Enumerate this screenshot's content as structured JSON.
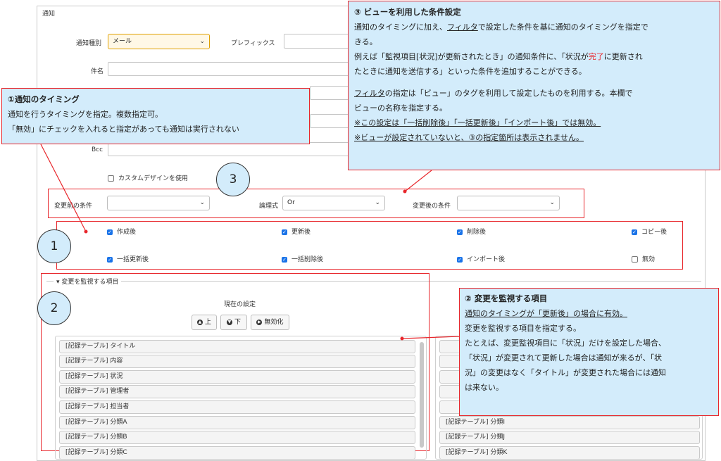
{
  "panel": {
    "title": "通知"
  },
  "form": {
    "notif_type_label": "通知種別",
    "notif_type_value": "メール",
    "prefix_label": "プレフィックス",
    "subject_label": "件名",
    "bcc_label": "Bcc",
    "custom_design_label": "カスタムデザインを使用",
    "before_condition_label": "変更前の条件",
    "logic_label": "論理式",
    "logic_value": "Or",
    "after_condition_label": "変更後の条件"
  },
  "timing": {
    "items": [
      {
        "label": "作成後",
        "checked": true
      },
      {
        "label": "更新後",
        "checked": true
      },
      {
        "label": "削除後",
        "checked": true
      },
      {
        "label": "コピー後",
        "checked": true
      },
      {
        "label": "一括更新後",
        "checked": true
      },
      {
        "label": "一括削除後",
        "checked": true
      },
      {
        "label": "インポート後",
        "checked": true
      },
      {
        "label": "無効",
        "checked": false
      }
    ]
  },
  "monitor": {
    "legend": "▾ 変更を監視する項目",
    "current_label": "現在の設定",
    "btn_up": "上",
    "btn_down": "下",
    "btn_disable": "無効化",
    "left_items": [
      "[記録テーブル] タイトル",
      "[記録テーブル] 内容",
      "[記録テーブル] 状況",
      "[記録テーブル] 管理者",
      "[記録テーブル] 担当者",
      "[記録テーブル] 分類A",
      "[記録テーブル] 分類B",
      "[記録テーブル] 分類C"
    ],
    "right_items": [
      "[記録テーブル] 分類I",
      "[記録テーブル] 分類J",
      "[記録テーブル] 分類K"
    ]
  },
  "circles": {
    "one": "1",
    "two": "2",
    "three": "3"
  },
  "callout1": {
    "title": "①通知のタイミング",
    "line1": "通知を行うタイミングを指定。複数指定可。",
    "line2": "「無効」にチェックを入れると指定があっても通知は実行されない"
  },
  "callout2": {
    "title": "② 変更を監視する項目",
    "line1": "通知のタイミングが「更新後」の場合に有効。",
    "line2": "変更を監視する項目を指定する。",
    "line3": "たとえば、変更監視項目に「状況」だけを設定した場合、",
    "line4": "「状況」が変更されて更新した場合は通知が来るが、「状",
    "line5": "況」の変更はなく「タイトル」が変更された場合には通知",
    "line6": "は来ない。"
  },
  "callout3": {
    "title": "③ ビューを利用した条件設定",
    "p1a": "通知のタイミングに加え、",
    "p1b": "フィルタ",
    "p1c": "で設定した条件を基に通知のタイミングを指定で",
    "p1d": "きる。",
    "p2a": "例えば「監視項目[状況]が更新されたとき」の通知条件に、「状況が",
    "p2b": "完了",
    "p2c": "に更新され",
    "p2d": "たときに通知を送信する」といった条件を追加することができる。",
    "p3a": "フィルタ",
    "p3b": "の指定は「ビュー」のタグを利用して設定したものを利用する。本欄で",
    "p3c": "ビューの名称を指定する。",
    "note1": "※この設定は「一括削除後」「一括更新後」「インポート後」では無効。",
    "note2": "※ビューが設定されていないと、③の指定箇所は表示されません。"
  },
  "colors": {
    "accent_red": "#e8262b",
    "callout_bg": "#d3ecfb",
    "checkbox_blue": "#1a73e8"
  }
}
